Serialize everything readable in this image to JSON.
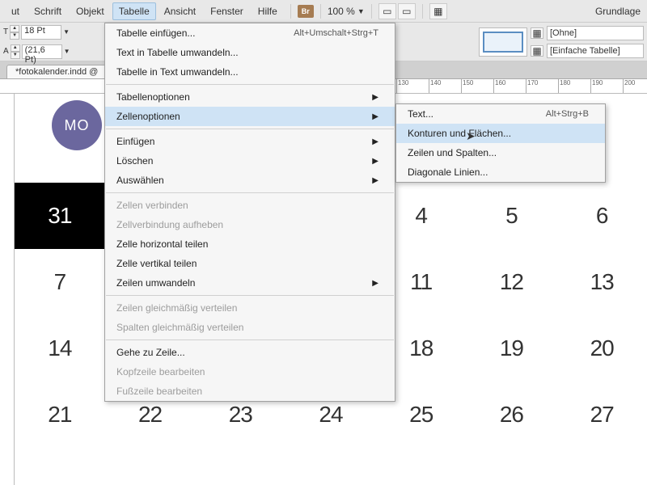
{
  "menubar": {
    "items": [
      "ut",
      "Schrift",
      "Objekt",
      "Tabelle",
      "Ansicht",
      "Fenster",
      "Hilfe"
    ],
    "active_index": 3,
    "br": "Br",
    "zoom": "100 %",
    "right": "Grundlage"
  },
  "controlbar": {
    "font_size": "18 Pt",
    "leading": "(21,6 Pt)",
    "styles": [
      "[Ohne]",
      "[Einfache Tabelle]"
    ]
  },
  "tab": {
    "label": "*fotokalender.indd @"
  },
  "ruler": {
    "guides": [
      130,
      140,
      150,
      160,
      170,
      180,
      190,
      200
    ]
  },
  "calendar": {
    "day_label": "MO",
    "rows": [
      [
        {
          "v": "31",
          "dark": true
        },
        {
          "hidden": true
        },
        {
          "hidden": true
        },
        {
          "v": "4"
        },
        {
          "v": "5"
        },
        {
          "v": "6"
        }
      ],
      [
        {
          "v": "7"
        },
        {
          "hidden": true
        },
        {
          "hidden": true
        },
        {
          "v": "11"
        },
        {
          "v": "12"
        },
        {
          "v": "13"
        }
      ],
      [
        {
          "v": "14"
        },
        {
          "hidden": true
        },
        {
          "hidden": true
        },
        {
          "v": "18"
        },
        {
          "v": "19"
        },
        {
          "v": "20"
        }
      ],
      [
        {
          "v": "21"
        },
        {
          "v": "22"
        },
        {
          "v": "23"
        },
        {
          "v": "24"
        },
        {
          "v": "25"
        },
        {
          "v": "26"
        },
        {
          "v": "27"
        }
      ]
    ]
  },
  "menu_main": [
    {
      "label": "Tabelle einfügen...",
      "shortcut": "Alt+Umschalt+Strg+T"
    },
    {
      "label": "Text in Tabelle umwandeln..."
    },
    {
      "label": "Tabelle in Text umwandeln..."
    },
    {
      "divider": true
    },
    {
      "label": "Tabellenoptionen",
      "sub": true
    },
    {
      "label": "Zellenoptionen",
      "sub": true,
      "hl": true
    },
    {
      "divider": true
    },
    {
      "label": "Einfügen",
      "sub": true
    },
    {
      "label": "Löschen",
      "sub": true
    },
    {
      "label": "Auswählen",
      "sub": true
    },
    {
      "divider": true
    },
    {
      "label": "Zellen verbinden",
      "disabled": true
    },
    {
      "label": "Zellverbindung aufheben",
      "disabled": true
    },
    {
      "label": "Zelle horizontal teilen"
    },
    {
      "label": "Zelle vertikal teilen"
    },
    {
      "label": "Zeilen umwandeln",
      "sub": true
    },
    {
      "divider": true
    },
    {
      "label": "Zeilen gleichmäßig verteilen",
      "disabled": true
    },
    {
      "label": "Spalten gleichmäßig verteilen",
      "disabled": true
    },
    {
      "divider": true
    },
    {
      "label": "Gehe zu Zeile..."
    },
    {
      "label": "Kopfzeile bearbeiten",
      "disabled": true
    },
    {
      "label": "Fußzeile bearbeiten",
      "disabled": true
    }
  ],
  "menu_sub": [
    {
      "label": "Text...",
      "shortcut": "Alt+Strg+B"
    },
    {
      "label": "Konturen und Flächen...",
      "hl": true
    },
    {
      "label": "Zeilen und Spalten..."
    },
    {
      "label": "Diagonale Linien..."
    }
  ]
}
